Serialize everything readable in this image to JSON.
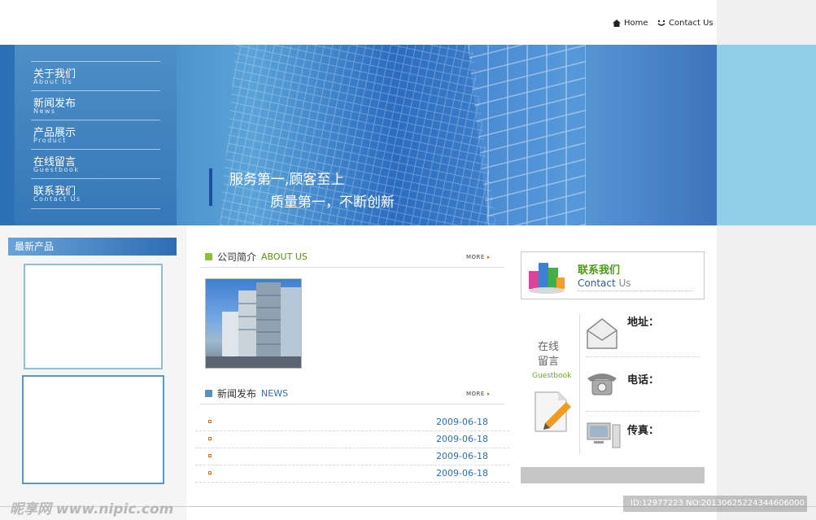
{
  "header": {
    "home_label": "Home",
    "contact_label": "Contact Us"
  },
  "nav": [
    {
      "cn": "关于我们",
      "en": "About Us"
    },
    {
      "cn": "新闻发布",
      "en": "News"
    },
    {
      "cn": "产品展示",
      "en": "Product"
    },
    {
      "cn": "在线留言",
      "en": "Guestbook"
    },
    {
      "cn": "联系我们",
      "en": "Contact Us"
    }
  ],
  "banner": {
    "slogan_line1": "服务第一,顾客至上",
    "slogan_line2": "质量第一，不断创新"
  },
  "sidebar": {
    "title": "最新产品"
  },
  "about": {
    "title_cn": "公司简介",
    "title_en": "ABOUT US",
    "more": "MORE"
  },
  "news": {
    "title_cn": "新闻发布",
    "title_en": "NEWS",
    "more": "MORE",
    "items": [
      {
        "date": "2009-06-18"
      },
      {
        "date": "2009-06-18"
      },
      {
        "date": "2009-06-18"
      },
      {
        "date": "2009-06-18"
      }
    ]
  },
  "contact": {
    "title_cn": "联系我们",
    "title_en_a": "Contact",
    "title_en_b": " Us",
    "guestbook_cn": "在线留言",
    "guestbook_en": "Guestbook",
    "address_label": "地址：",
    "phone_label": "电话：",
    "fax_label": "传真："
  },
  "watermark": {
    "left": "昵享网 www.nipic.com",
    "right": "ID:12977223 NO:20130625224344606000"
  },
  "colors": {
    "accent_blue": "#2f6fb8",
    "accent_green": "#4a9a16",
    "accent_orange": "#e07020"
  }
}
